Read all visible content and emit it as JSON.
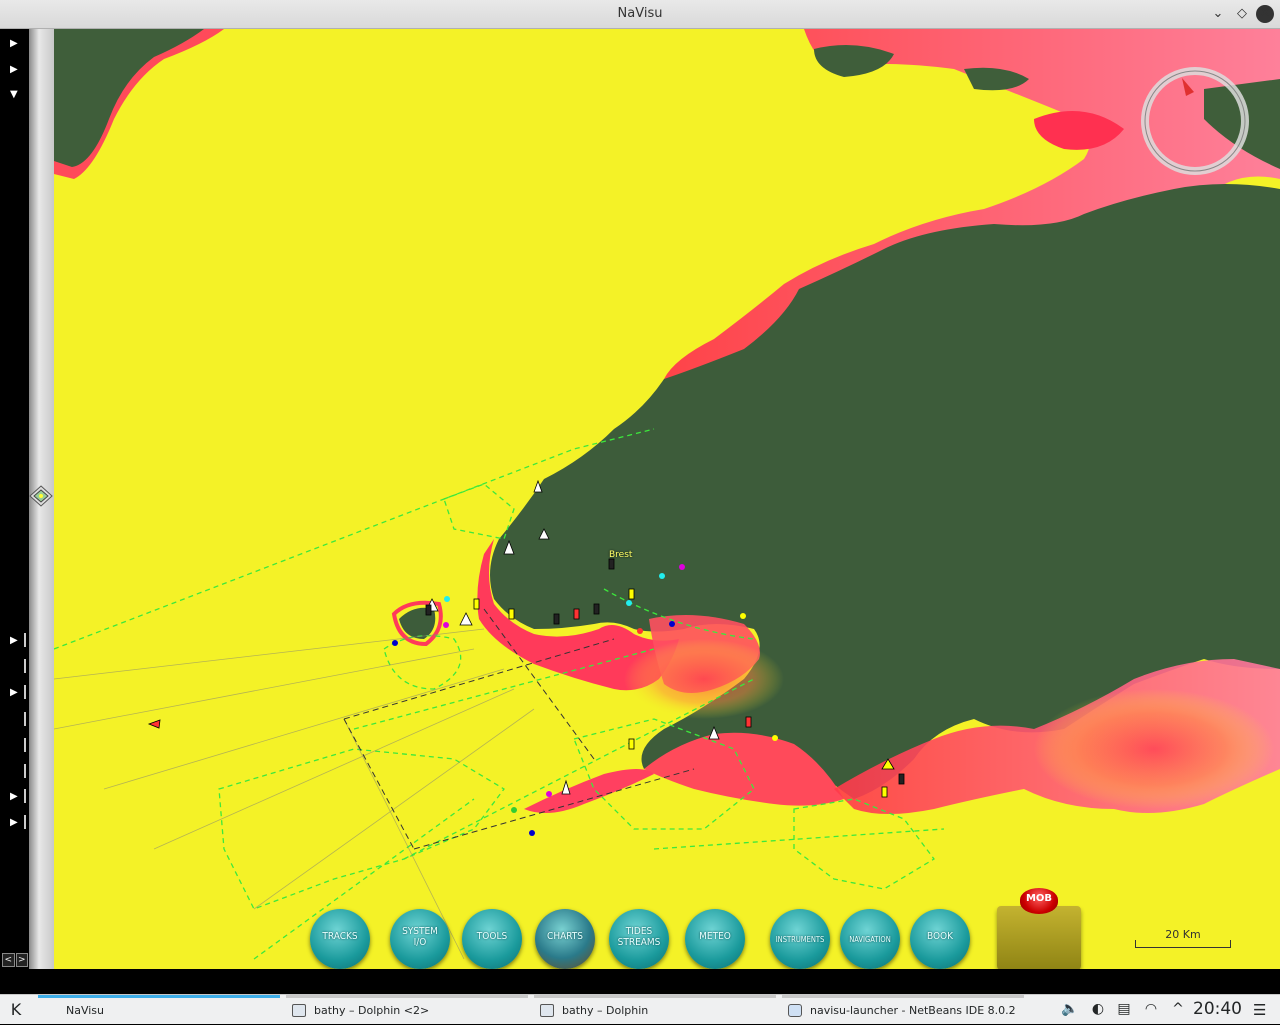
{
  "window": {
    "title": "NaVisu",
    "controls": {
      "minimize": "⌄",
      "maximize": "◇",
      "close": "✕"
    }
  },
  "map": {
    "city_label": "Brest",
    "scale_label": "20 Km",
    "colors": {
      "sea_shallow": "#f4f227",
      "sea_depth_red": "#ff4040",
      "land": "#3d5c3a",
      "route_lines": "#3ce83c"
    }
  },
  "toolbar": {
    "tracks": "TRACKS",
    "system_io_line1": "SYSTEM",
    "system_io_line2": "I/O",
    "tools": "TOOLS",
    "charts": "CHARTS",
    "tides_line1": "TIDES",
    "tides_line2": "STREAMS",
    "meteo": "METEO",
    "instruments": "INSTRUMENTS",
    "navigation": "NAVIGATION",
    "book": "BOOK",
    "mob": "MOB"
  },
  "taskbar": {
    "tasks": [
      {
        "label": "NaVisu"
      },
      {
        "label": "bathy – Dolphin <2>"
      },
      {
        "label": "bathy – Dolphin"
      },
      {
        "label": "navisu-launcher - NetBeans IDE 8.0.2"
      }
    ],
    "clock": "20:40"
  }
}
